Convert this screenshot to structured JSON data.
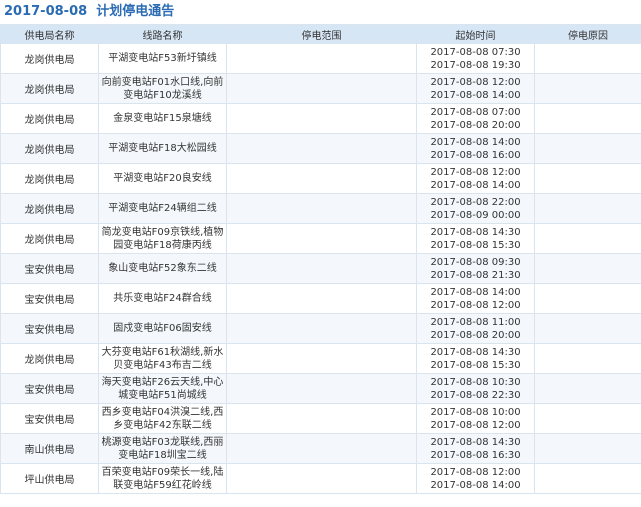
{
  "notice": {
    "date": "2017-08-08",
    "title": "计划停电通告"
  },
  "headers": [
    "供电局名称",
    "线路名称",
    "停电范围",
    "起始时间",
    "停电原因"
  ],
  "rows": [
    {
      "bureau": "龙岗供电局",
      "line": "平湖变电站F53新圩镇线",
      "range": "",
      "start": "2017-08-08 07:30",
      "end": "2017-08-08 19:30",
      "reason": ""
    },
    {
      "bureau": "龙岗供电局",
      "line": "向前变电站F01水口线,向前变电站F10龙溪线",
      "range": "",
      "start": "2017-08-08 12:00",
      "end": "2017-08-08 14:00",
      "reason": ""
    },
    {
      "bureau": "龙岗供电局",
      "line": "金泉变电站F15泉塘线",
      "range": "",
      "start": "2017-08-08 07:00",
      "end": "2017-08-08 20:00",
      "reason": ""
    },
    {
      "bureau": "龙岗供电局",
      "line": "平湖变电站F18大松园线",
      "range": "",
      "start": "2017-08-08 14:00",
      "end": "2017-08-08 16:00",
      "reason": ""
    },
    {
      "bureau": "龙岗供电局",
      "line": "平湖变电站F20良安线",
      "range": "",
      "start": "2017-08-08 12:00",
      "end": "2017-08-08 14:00",
      "reason": ""
    },
    {
      "bureau": "龙岗供电局",
      "line": "平湖变电站F24辆组二线",
      "range": "",
      "start": "2017-08-08 22:00",
      "end": "2017-08-09 00:00",
      "reason": ""
    },
    {
      "bureau": "龙岗供电局",
      "line": "简龙变电站F09京铁线,植物园变电站F18荷康丙线",
      "range": "",
      "start": "2017-08-08 14:30",
      "end": "2017-08-08 15:30",
      "reason": ""
    },
    {
      "bureau": "宝安供电局",
      "line": "象山变电站F52象东二线",
      "range": "",
      "start": "2017-08-08 09:30",
      "end": "2017-08-08 21:30",
      "reason": ""
    },
    {
      "bureau": "宝安供电局",
      "line": "共乐变电站F24群合线",
      "range": "",
      "start": "2017-08-08 14:00",
      "end": "2017-08-08 12:00",
      "reason": ""
    },
    {
      "bureau": "宝安供电局",
      "line": "固戍变电站F06固安线",
      "range": "",
      "start": "2017-08-08 11:00",
      "end": "2017-08-08 20:00",
      "reason": ""
    },
    {
      "bureau": "龙岗供电局",
      "line": "大芬变电站F61秋湖线,新水贝变电站F43布吉二线",
      "range": "",
      "start": "2017-08-08 14:30",
      "end": "2017-08-08 15:30",
      "reason": ""
    },
    {
      "bureau": "宝安供电局",
      "line": "海天变电站F26云天线,中心城变电站F51尚城线",
      "range": "",
      "start": "2017-08-08 10:30",
      "end": "2017-08-08 22:30",
      "reason": ""
    },
    {
      "bureau": "宝安供电局",
      "line": "西乡变电站F04洪溴二线,西乡变电站F42东联二线",
      "range": "",
      "start": "2017-08-08 10:00",
      "end": "2017-08-08 12:00",
      "reason": ""
    },
    {
      "bureau": "南山供电局",
      "line": "桃源变电站F03龙联线,西丽变电站F18圳宝二线",
      "range": "",
      "start": "2017-08-08 14:30",
      "end": "2017-08-08 16:30",
      "reason": ""
    },
    {
      "bureau": "坪山供电局",
      "line": "百荣变电站F09荣长一线,陆联变电站F59红花岭线",
      "range": "",
      "start": "2017-08-08 12:00",
      "end": "2017-08-08 14:00",
      "reason": ""
    }
  ]
}
